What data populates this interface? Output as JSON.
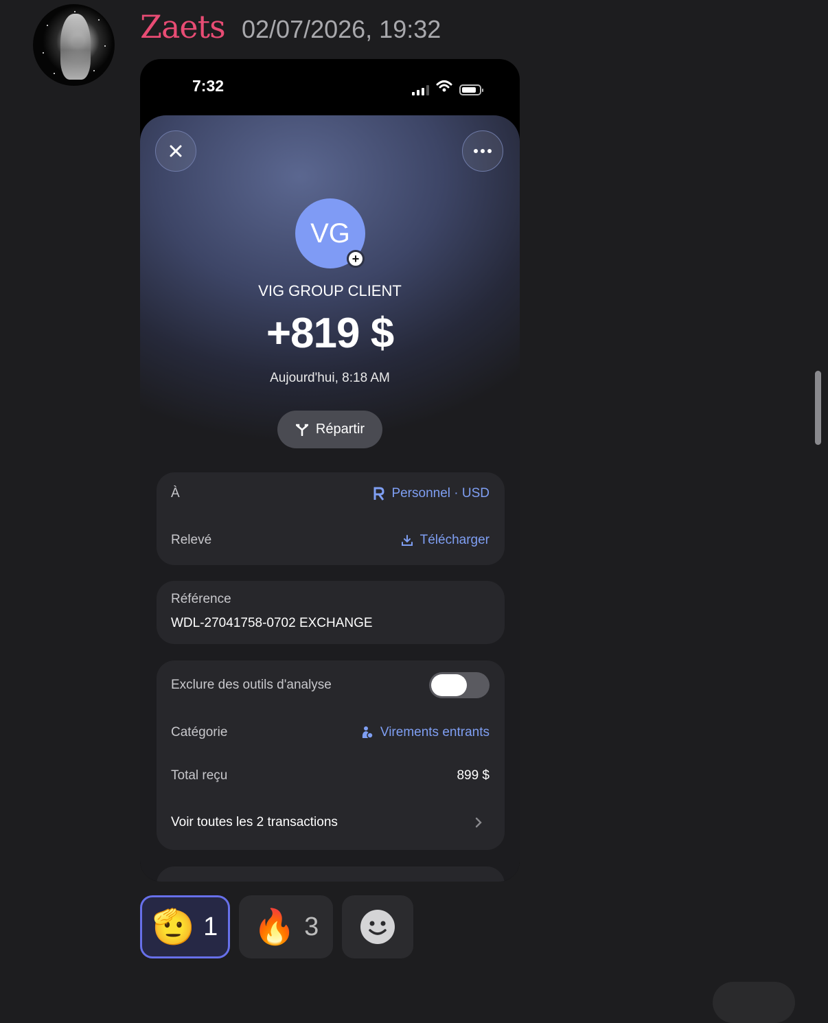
{
  "message": {
    "username": "Zaets",
    "timestamp": "02/07/2026, 19:32",
    "username_color": "#e84c74"
  },
  "phone": {
    "status_time": "7:32",
    "icons": [
      "signal-icon",
      "wifi-icon",
      "battery-icon"
    ]
  },
  "transaction": {
    "avatar_initials": "VG",
    "merchant": "VIG GROUP CLIENT",
    "amount": "+819 $",
    "datetime": "Aujourd'hui, 8:18 AM",
    "split_label": "Répartir",
    "accent_color": "#7f9ff3",
    "to_label": "À",
    "to_value": "Personnel · USD",
    "statement_label": "Relevé",
    "statement_action": "Télécharger",
    "reference_label": "Référence",
    "reference_value": "WDL-27041758-0702 EXCHANGE",
    "exclude_label": "Exclure des outils d'analyse",
    "exclude_enabled": false,
    "category_label": "Catégorie",
    "category_value": "Virements entrants",
    "total_label": "Total reçu",
    "total_value": "899 $",
    "all_transactions": "Voir toutes les 2 transactions"
  },
  "reactions": [
    {
      "emoji": "🫡",
      "icon": "saluting-face-icon",
      "count": "1",
      "active": true
    },
    {
      "emoji": "🔥",
      "icon": "fire-icon",
      "count": "3",
      "active": false
    },
    {
      "icon": "add-reaction-icon",
      "active": false
    }
  ]
}
